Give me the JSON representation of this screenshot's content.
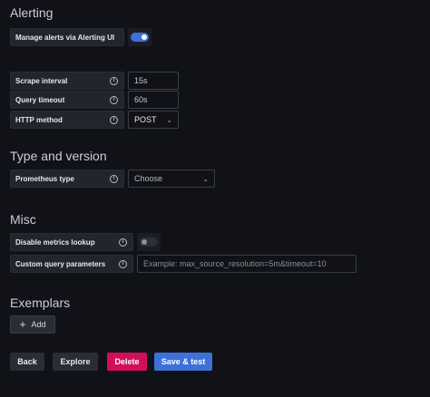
{
  "headings": {
    "alerting": "Alerting",
    "type_version": "Type and version",
    "misc": "Misc",
    "exemplars": "Exemplars"
  },
  "alerting": {
    "manage_label": "Manage alerts via Alerting UI",
    "manage_enabled": true
  },
  "fields": {
    "scrape_interval_label": "Scrape interval",
    "scrape_interval_value": "15s",
    "query_timeout_label": "Query timeout",
    "query_timeout_value": "60s",
    "http_method_label": "HTTP method",
    "http_method_value": "POST",
    "prometheus_type_label": "Prometheus type",
    "prometheus_type_value": "Choose",
    "disable_metrics_label": "Disable metrics lookup",
    "disable_metrics_enabled": false,
    "custom_query_label": "Custom query parameters",
    "custom_query_placeholder": "Example: max_source_resolution=5m&timeout=10"
  },
  "info_glyph": "i",
  "chevron_glyph": "⌄",
  "exemplars": {
    "add_label": "Add",
    "add_glyph": "+"
  },
  "actions": {
    "back": "Back",
    "explore": "Explore",
    "delete": "Delete",
    "save": "Save & test"
  },
  "colors": {
    "toggle_on": "#3d71d9",
    "delete": "#d10e5c",
    "save": "#3d71d9"
  }
}
